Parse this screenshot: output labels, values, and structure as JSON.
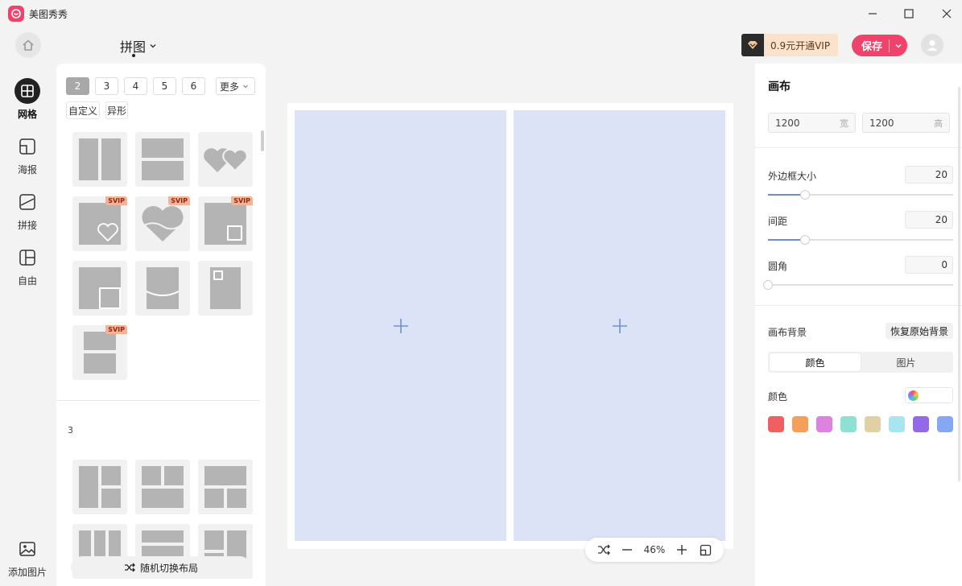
{
  "app": {
    "title": "美图秀秀"
  },
  "toolbar": {
    "mode_label": "拼图",
    "vip_label": "0.9元开通VIP",
    "save_label": "保存"
  },
  "nav": [
    {
      "label": "网格",
      "icon": "grid-icon",
      "active": true
    },
    {
      "label": "海报",
      "icon": "poster-icon",
      "active": false
    },
    {
      "label": "拼接",
      "icon": "stitch-icon",
      "active": false
    },
    {
      "label": "自由",
      "icon": "free-layout-icon",
      "active": false
    }
  ],
  "nav_bottom": {
    "label": "添加图片",
    "icon": "add-image-icon"
  },
  "templates": {
    "count_tabs": [
      "2",
      "3",
      "4",
      "5",
      "6"
    ],
    "active_count": "2",
    "more_label": "更多",
    "shape_tabs": [
      "自定义",
      "异形"
    ],
    "section_label": "3",
    "svip_label": "SVIP",
    "random_label": "随机切换布局"
  },
  "canvas": {
    "cell_count": 2
  },
  "zoom": {
    "value": "46%"
  },
  "right_panel": {
    "title": "画布",
    "width": "1200",
    "width_unit": "宽",
    "height": "1200",
    "height_unit": "高",
    "border_label": "外边框大小",
    "border_value": "20",
    "border_level": 0.2,
    "spacing_label": "间距",
    "spacing_value": "20",
    "spacing_level": 0.2,
    "corner_label": "圆角",
    "corner_value": "0",
    "corner_level": 0,
    "bg_label": "画布背景",
    "restore_label": "恢复原始背景",
    "tab_color": "颜色",
    "tab_image": "图片",
    "color_label": "颜色",
    "swatches": [
      "#f06060",
      "#f5a05a",
      "#dd82e0",
      "#8ee0d2",
      "#dfd0a6",
      "#a9e4f2",
      "#9468e8",
      "#86a8f2"
    ]
  },
  "colors": {
    "accent": "#f0436b",
    "cell": "#dce3f6",
    "plus": "#6e8fd6"
  }
}
